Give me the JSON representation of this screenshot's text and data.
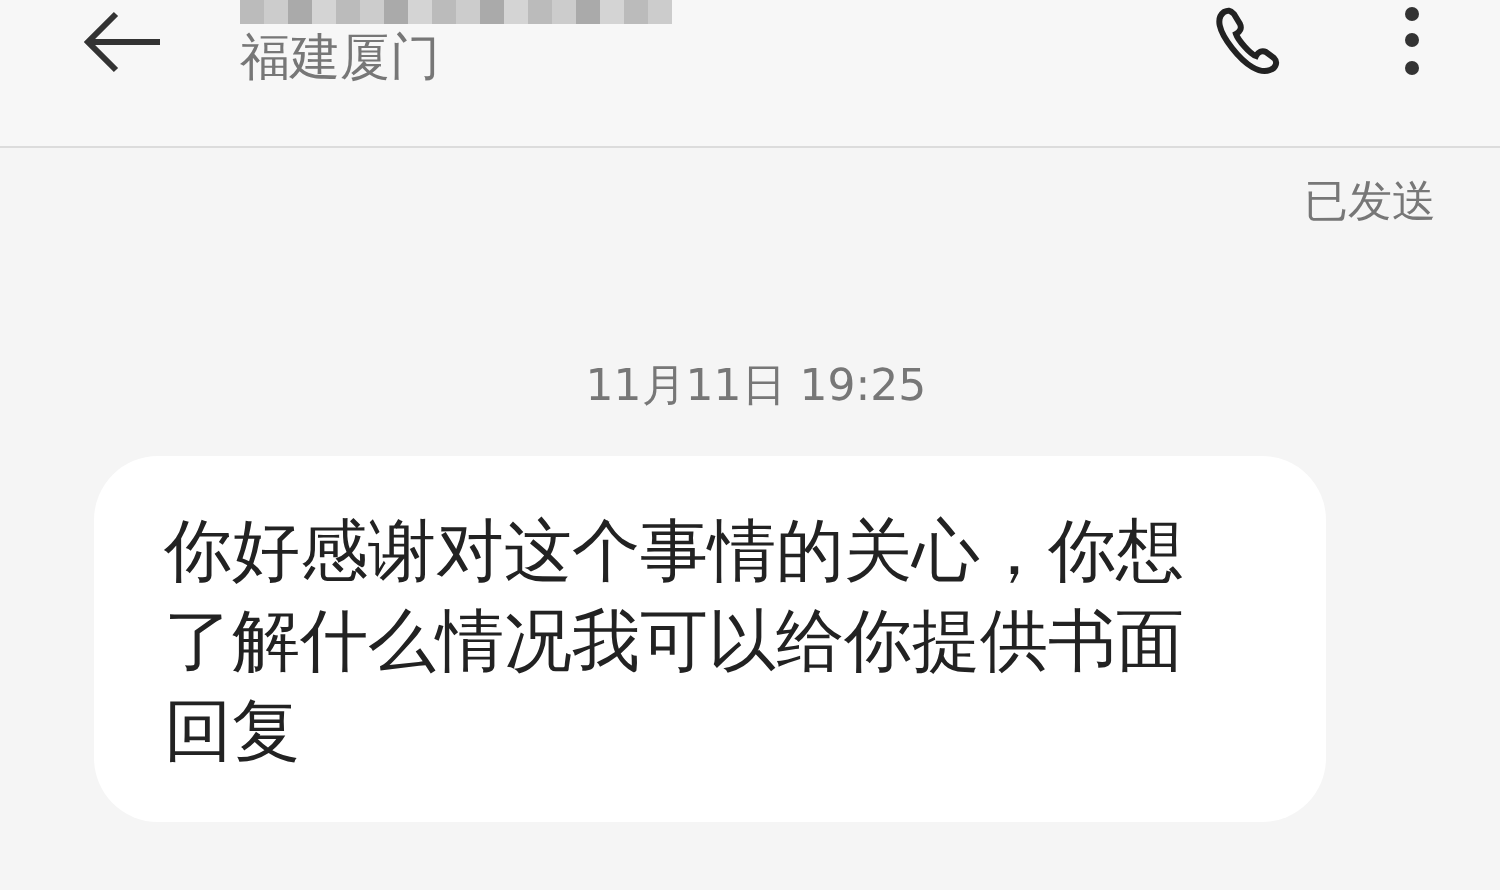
{
  "header": {
    "subtitle": "福建厦门"
  },
  "status": "已发送",
  "messages": [
    {
      "kind": "incoming",
      "time": "11月11日 19:25",
      "text": "你好感谢对这个事情的关心，你想了解什么情况我可以给你提供书面回复"
    }
  ]
}
